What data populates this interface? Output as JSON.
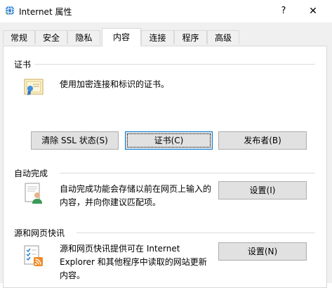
{
  "window": {
    "title": "Internet 属性",
    "help_glyph": "?",
    "close_glyph": "✕"
  },
  "tabs": [
    {
      "label": "常规"
    },
    {
      "label": "安全"
    },
    {
      "label": "隐私"
    },
    {
      "label": "内容"
    },
    {
      "label": "连接"
    },
    {
      "label": "程序"
    },
    {
      "label": "高级"
    }
  ],
  "certificates": {
    "heading": "证书",
    "description": "使用加密连接和标识的证书。",
    "clear_ssl_button": "清除 SSL 状态(S)",
    "certificates_button": "证书(C)",
    "publishers_button": "发布者(B)"
  },
  "autocomplete": {
    "heading": "自动完成",
    "description_line1": "自动完成功能会存储以前在网页上输入的",
    "description_line2": "内容，并向你建议匹配项。",
    "settings_button": "设置(I)"
  },
  "feeds": {
    "heading": "源和网页快讯",
    "description_line1": "源和网页快讯提供可在 Internet",
    "description_line2": "Explorer 和其他程序中读取的网站更新",
    "description_line3": "内容。",
    "settings_button": "设置(N)"
  },
  "colors": {
    "accent": "#0078d7",
    "dialog_bg": "#f0f0f0",
    "button_bg": "#e1e1e1"
  }
}
